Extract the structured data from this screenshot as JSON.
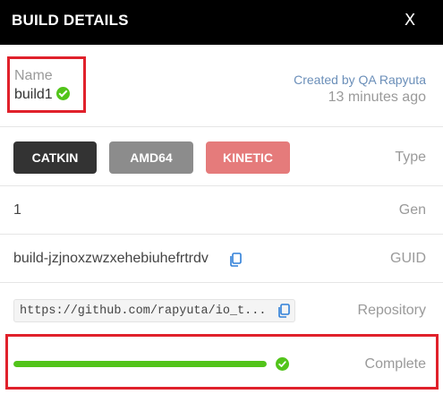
{
  "header": {
    "title": "BUILD DETAILS",
    "close_label": "X"
  },
  "name": {
    "label": "Name",
    "value": "build1",
    "status_icon": "check-circle-icon",
    "status_color": "#52c41a"
  },
  "created": {
    "by": "Created by QA Rapyuta",
    "ago": "13 minutes ago"
  },
  "type": {
    "label": "Type",
    "tags": [
      "CATKIN",
      "AMD64",
      "KINETIC"
    ],
    "tag_colors": [
      "#333333",
      "#8c8c8c",
      "#e57b7b"
    ]
  },
  "gen": {
    "label": "Gen",
    "value": "1"
  },
  "guid": {
    "label": "GUID",
    "value": "build-jzjnoxzwzxehebiuhefrtrdv",
    "copy_icon": "copy-icon"
  },
  "repository": {
    "label": "Repository",
    "value": "https://github.com/rapyuta/io_t...",
    "copy_icon": "copy-icon"
  },
  "status": {
    "label": "Complete",
    "progress_percent": 100,
    "progress_color": "#52c41a",
    "icon": "check-circle-icon"
  },
  "highlight_color": "#e0212b"
}
